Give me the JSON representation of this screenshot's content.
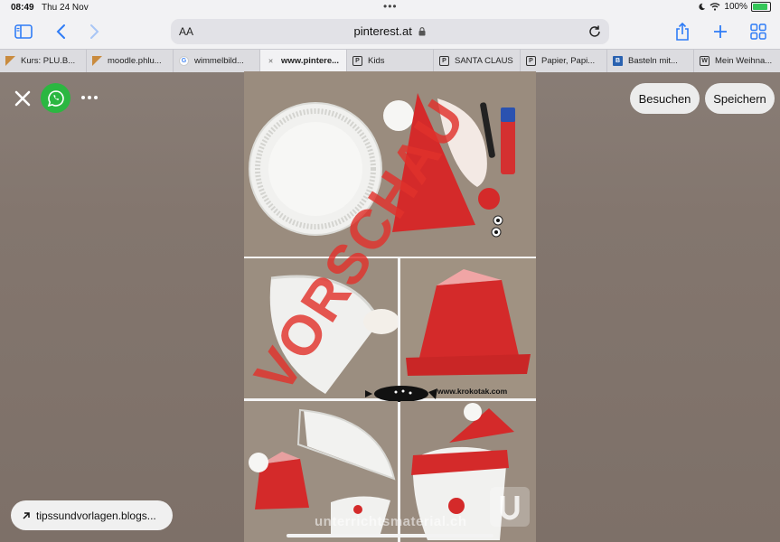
{
  "status_bar": {
    "time": "08:49",
    "date": "Thu 24 Nov",
    "battery": "100%"
  },
  "address_bar": {
    "text_size_label": "AA",
    "url": "pinterest.at"
  },
  "tabs": [
    {
      "label": "Kurs: PLU.B...",
      "favicon": "orange-flag-icon"
    },
    {
      "label": "moodle.phlu...",
      "favicon": "orange-flag-icon"
    },
    {
      "label": "wimmelbild...",
      "favicon": "google-icon"
    },
    {
      "label": "www.pintere...",
      "favicon": "close-icon",
      "active": true
    },
    {
      "label": "Kids",
      "favicon": "p-icon"
    },
    {
      "label": "SANTA CLAUS",
      "favicon": "p-icon"
    },
    {
      "label": "Papier, Papi...",
      "favicon": "p-icon"
    },
    {
      "label": "Basteln mit...",
      "favicon": "b-icon"
    },
    {
      "label": "Mein Weihna...",
      "favicon": "w-icon"
    }
  ],
  "actions": {
    "visit_label": "Besuchen",
    "save_label": "Speichern"
  },
  "source": {
    "label": "tipssundvorlagen.blogs..."
  },
  "pin": {
    "credit_text": "www.krokotak.com",
    "watermark_text": "unterrichtsmaterial.ch",
    "overlay_text": "VORSCHAU"
  },
  "colors": {
    "accent": "#2f7cf6",
    "whatsapp": "#2bb741",
    "paper_red": "#d42a2a",
    "overlay_red": "#e0322c"
  }
}
